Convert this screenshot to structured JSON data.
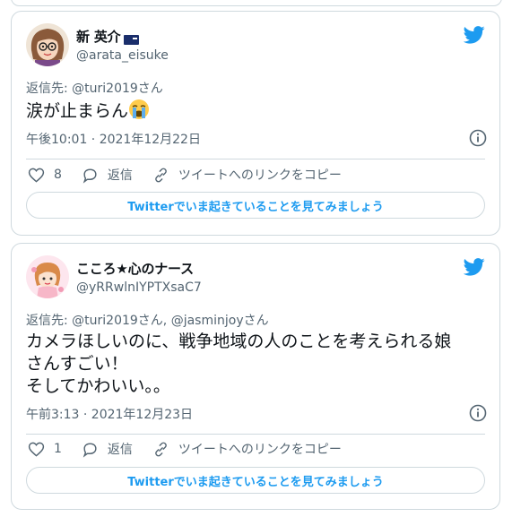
{
  "tweets": [
    {
      "display_name": "新 英介",
      "handle": "@arata_eisuke",
      "reply_to": "返信先: @turi2019さん",
      "text": "涙が止まらん",
      "emoji": "loudly-crying-face",
      "time": "午後10:01 · 2021年12月22日",
      "likes": "8",
      "reply_label": "返信",
      "copy_link_label": "ツイートへのリンクをコピー",
      "cta": "Twitterでいま起きていることを見てみましょう"
    },
    {
      "display_name": "こころ★心のナース",
      "handle": "@yRRwlnIYPTXsaC7",
      "reply_to": "返信先: @turi2019さん, @jasminjoyさん",
      "text_line1": "カメラほしいのに、戦争地域の人のことを考えられる娘",
      "text_line2": "さんすごい！",
      "text_line3": "そしてかわいい。。",
      "time": "午前3:13 · 2021年12月23日",
      "likes": "1",
      "reply_label": "返信",
      "copy_link_label": "ツイートへのリンクをコピー",
      "cta": "Twitterでいま起きていることを見てみましょう"
    }
  ],
  "colors": {
    "twitter_blue": "#1d9bf0",
    "secondary_text": "#536471",
    "border": "#cfd9de"
  }
}
